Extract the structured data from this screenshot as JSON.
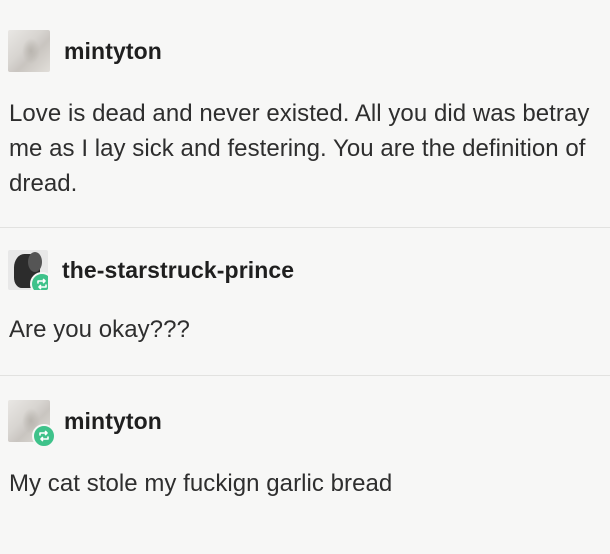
{
  "posts": [
    {
      "username": "mintyton",
      "avatar_icon": "mintyton-avatar",
      "reblog": false,
      "text": "Love is dead and never existed. All you did was betray me as I lay sick and festering. You are the definition of dread."
    },
    {
      "username": "the-starstruck-prince",
      "avatar_icon": "the-starstruck-prince-avatar",
      "reblog": true,
      "text": "Are you okay???"
    },
    {
      "username": "mintyton",
      "avatar_icon": "mintyton-avatar",
      "reblog": true,
      "text": "My cat stole my fuckign garlic bread"
    }
  ],
  "colors": {
    "background": "#f7f7f6",
    "text": "#2e2e2e",
    "reblog_badge": "#3ec28a",
    "divider": "#e2e2e0"
  }
}
